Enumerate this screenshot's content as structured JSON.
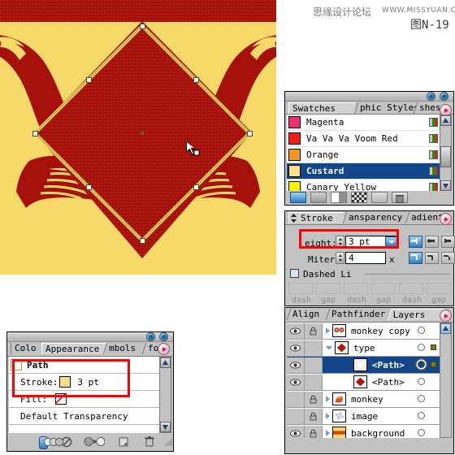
{
  "watermark": {
    "forum": "思缘设计论坛",
    "url": "WWW.MISSYUAN.COM",
    "figure": "图N-19"
  },
  "canvas": {
    "name": "illustrator-artboard",
    "background_color": "#f7d96a",
    "artwork_color": "#a51008",
    "selected_path": "diamond",
    "stroke_color": "#f2d96b",
    "anchor_count": 8,
    "cursor": "arrow-with-square"
  },
  "swatches_panel": {
    "tabs": [
      {
        "label": "Swatches",
        "selected": true
      },
      {
        "label": "phic Styles",
        "selected": false
      },
      {
        "label": "shes",
        "selected": false
      }
    ],
    "rows": [
      {
        "name": "Magenta",
        "color": "#ec2e72",
        "selected": false
      },
      {
        "name": "Va Va Va Voom Red",
        "color": "#f21b16",
        "selected": false
      },
      {
        "name": "Orange",
        "color": "#f79420",
        "selected": false
      },
      {
        "name": "Custard",
        "color": "#f8dd8a",
        "selected": true
      },
      {
        "name": "Canary Yellow",
        "color": "#fff200",
        "selected": false
      }
    ],
    "footer_buttons": [
      "swatch-libraries-button",
      "show-swatch-kinds-button",
      "new-color-group-button",
      "swatch-options-button",
      "new-swatch-button",
      "delete-swatch-button"
    ]
  },
  "stroke_panel": {
    "tabs": [
      {
        "label": "Stroke",
        "selected": true
      },
      {
        "label": "ansparency",
        "selected": false
      },
      {
        "label": "adient",
        "selected": false
      }
    ],
    "weight_label": "eight:",
    "weight_value": "3 pt",
    "miter_label": "Miter",
    "miter_value": "4",
    "miter_unit": "x",
    "dashed_label": "Dashed Li",
    "dashed_checked": false,
    "dash_labels": [
      "dash",
      "gap",
      "dash",
      "gap",
      "dash",
      "gap"
    ],
    "cap_buttons": [
      "butt-cap",
      "round-cap",
      "projecting-cap"
    ],
    "join_buttons": [
      "miter-join",
      "round-join",
      "bevel-join"
    ]
  },
  "layers_panel": {
    "tabs": [
      {
        "label": "Align",
        "selected": false
      },
      {
        "label": "Pathfinder",
        "selected": false
      },
      {
        "label": "Layers",
        "selected": true
      }
    ],
    "rows": [
      {
        "name": "monkey copy",
        "visible": true,
        "locked": true,
        "indent": 0,
        "expand": "closed",
        "selected": false,
        "thumb": "monkey-copy-thumb",
        "marker": "none"
      },
      {
        "name": "type",
        "visible": true,
        "locked": false,
        "indent": 0,
        "expand": "open",
        "selected": false,
        "thumb": "red-diamond-thumb",
        "marker": "olive"
      },
      {
        "name": "<Path>",
        "visible": true,
        "locked": false,
        "indent": 1,
        "expand": "none",
        "selected": true,
        "thumb": "white-circle-thumb",
        "marker": "olive"
      },
      {
        "name": "<Path>",
        "visible": true,
        "locked": false,
        "indent": 1,
        "expand": "none",
        "selected": false,
        "thumb": "red-diamond-thumb",
        "marker": "none"
      },
      {
        "name": "monkey",
        "visible": false,
        "locked": true,
        "indent": 0,
        "expand": "closed",
        "selected": false,
        "thumb": "monkey-thumb",
        "marker": "none"
      },
      {
        "name": "image",
        "visible": false,
        "locked": true,
        "indent": 0,
        "expand": "closed",
        "selected": false,
        "thumb": "image-thumb",
        "marker": "none"
      },
      {
        "name": "background",
        "visible": true,
        "locked": true,
        "indent": 0,
        "expand": "closed",
        "selected": false,
        "thumb": "background-thumb",
        "marker": "none"
      }
    ]
  },
  "appearance_panel": {
    "tabs": [
      {
        "label": "Colo",
        "selected": false
      },
      {
        "label": "Appearance",
        "selected": true
      },
      {
        "label": "mbols",
        "selected": false
      },
      {
        "label": "fo",
        "selected": false
      }
    ],
    "title": "Path",
    "rows": [
      {
        "label": "Stroke:",
        "value": "3 pt",
        "swatch": "#f8dd8a"
      },
      {
        "label": "Fill:",
        "value": "",
        "swatch": "none"
      }
    ],
    "footer_text": "Default Transparency",
    "footer_buttons": [
      "new-art-has-basic-appearance-button",
      "clear-appearance-button",
      "reduce-to-basic-appearance-button",
      "duplicate-item-button",
      "delete-item-button"
    ]
  }
}
